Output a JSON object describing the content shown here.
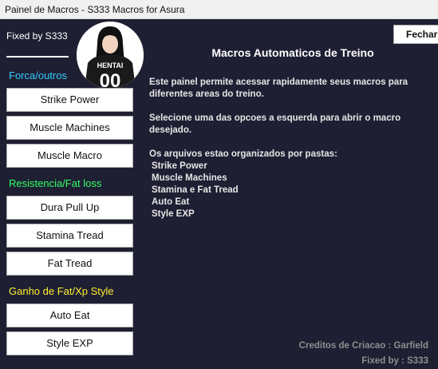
{
  "window": {
    "title": "Painel de Macros - S333 Macros for Asura"
  },
  "sidebar": {
    "fixed_by": "Fixed by S333",
    "avatar": {
      "shirt_text": "HENTAI",
      "shirt_number": "00"
    },
    "sections": [
      {
        "label": "Forca/outros",
        "color": "#33ccff",
        "buttons": [
          "Strike Power",
          "Muscle Machines",
          "Muscle Macro"
        ]
      },
      {
        "label": "Resistencia/Fat loss",
        "color": "#33ff66",
        "buttons": [
          "Dura Pull Up",
          "Stamina Tread",
          "Fat Tread"
        ]
      },
      {
        "label": "Ganho de Fat/Xp Style",
        "color": "#ffee33",
        "buttons": [
          "Auto Eat",
          "Style EXP"
        ]
      }
    ]
  },
  "toolbar": {
    "close_label": "Fechar"
  },
  "main": {
    "heading": "Macros Automaticos de Treino",
    "paragraph1": "Este painel permite acessar rapidamente seus macros para\ndiferentes areas do treino.",
    "paragraph2": "Selecione uma das opcoes a esquerda para abrir o macro\ndesejado.",
    "paragraph3_intro": "Os arquivos estao organizados por pastas:",
    "folders": [
      "Strike Power",
      "Muscle Machines",
      "Stamina e Fat Tread",
      "Auto Eat",
      "Style EXP"
    ]
  },
  "footer": {
    "credits": "Creditos de Criacao : Garfield",
    "fixed_by": "Fixed by : S333"
  }
}
